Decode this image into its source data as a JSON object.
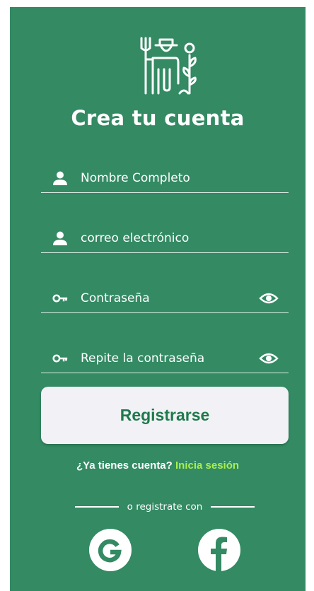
{
  "page": {
    "title": "Crea tu cuenta"
  },
  "form": {
    "fields": [
      {
        "placeholder": "Nombre Completo",
        "icon": "person-icon"
      },
      {
        "placeholder": "correo electrónico",
        "icon": "person-icon"
      },
      {
        "placeholder": "Contraseña",
        "icon": "key-icon",
        "toggle": "eye-icon"
      },
      {
        "placeholder": "Repite la contraseña",
        "icon": "key-icon",
        "toggle": "eye-icon"
      }
    ],
    "submit_label": "Registrarse"
  },
  "login": {
    "question": "¿Ya tienes cuenta?",
    "link_label": "Inicia sesión"
  },
  "social": {
    "divider_label": "o registrate con",
    "providers": [
      {
        "name": "google-icon"
      },
      {
        "name": "facebook-icon"
      }
    ]
  },
  "colors": {
    "background": "#338a63",
    "button_bg": "#f2f1f6",
    "button_text": "#1e7a4b",
    "link": "#a8f050"
  }
}
